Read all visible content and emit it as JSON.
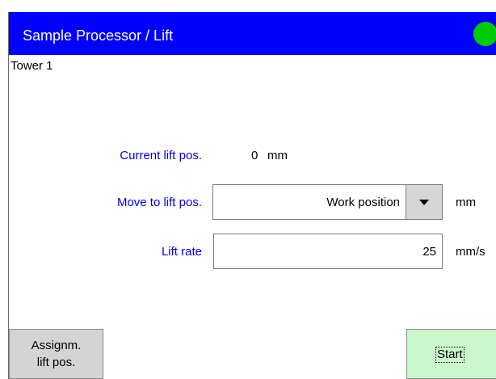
{
  "header": {
    "title": "Sample Processor / Lift",
    "status_color": "#00cc00",
    "bar_color": "#0000fe"
  },
  "tower_label": "Tower 1",
  "current_lift": {
    "label": "Current lift pos.",
    "value": "0",
    "unit": "mm"
  },
  "move_to": {
    "label": "Move to lift pos.",
    "value": "Work position",
    "unit": "mm",
    "dropdown_icon": "caret-down"
  },
  "lift_rate": {
    "label": "Lift rate",
    "value": "25",
    "unit": "mm/s"
  },
  "buttons": {
    "assign_line1": "Assignm.",
    "assign_line2": "lift pos.",
    "start": "Start",
    "start_color": "#ccf7cc"
  }
}
